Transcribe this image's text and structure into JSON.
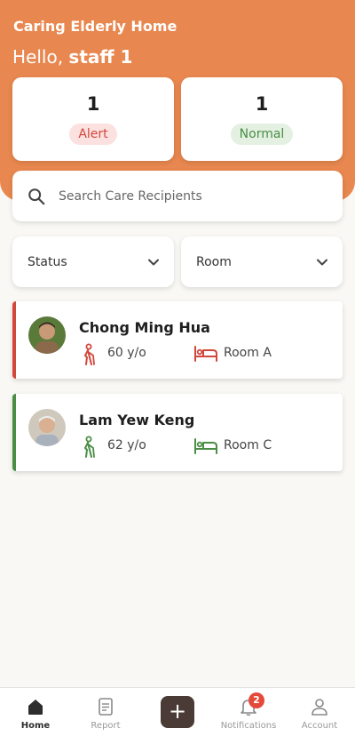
{
  "header": {
    "app_title": "Caring Elderly Home",
    "greeting_prefix": "Hello,",
    "greeting_name": "staff 1"
  },
  "summary": [
    {
      "count": "1",
      "label": "Alert",
      "color": "#d2473c"
    },
    {
      "count": "1",
      "label": "Normal",
      "color": "#4a8e45"
    }
  ],
  "search": {
    "placeholder": "Search Care Recipients",
    "icon": "search-icon"
  },
  "filters": [
    {
      "label": "Status",
      "icon": "chevron-down-icon"
    },
    {
      "label": "Room",
      "icon": "chevron-down-icon"
    }
  ],
  "recipients": [
    {
      "name": "Chong Ming Hua",
      "age": "60 y/o",
      "room": "Room A",
      "status": "alert",
      "status_color": "#d2473c"
    },
    {
      "name": "Lam Yew Keng",
      "age": "62 y/o",
      "room": "Room C",
      "status": "normal",
      "status_color": "#4a8e45"
    }
  ],
  "nav": {
    "items": [
      {
        "label": "Home",
        "icon": "home-icon",
        "active": true
      },
      {
        "label": "Report",
        "icon": "document-icon"
      },
      {
        "label": "+",
        "icon": "plus-icon"
      },
      {
        "label": "Notifications",
        "icon": "bell-icon",
        "badge": "2"
      },
      {
        "label": "Account",
        "icon": "person-icon"
      }
    ]
  },
  "colors": {
    "header": "#e8874f",
    "background": "#f9f8f4",
    "add_button": "#4b3b36",
    "badge": "#e34a3b"
  }
}
